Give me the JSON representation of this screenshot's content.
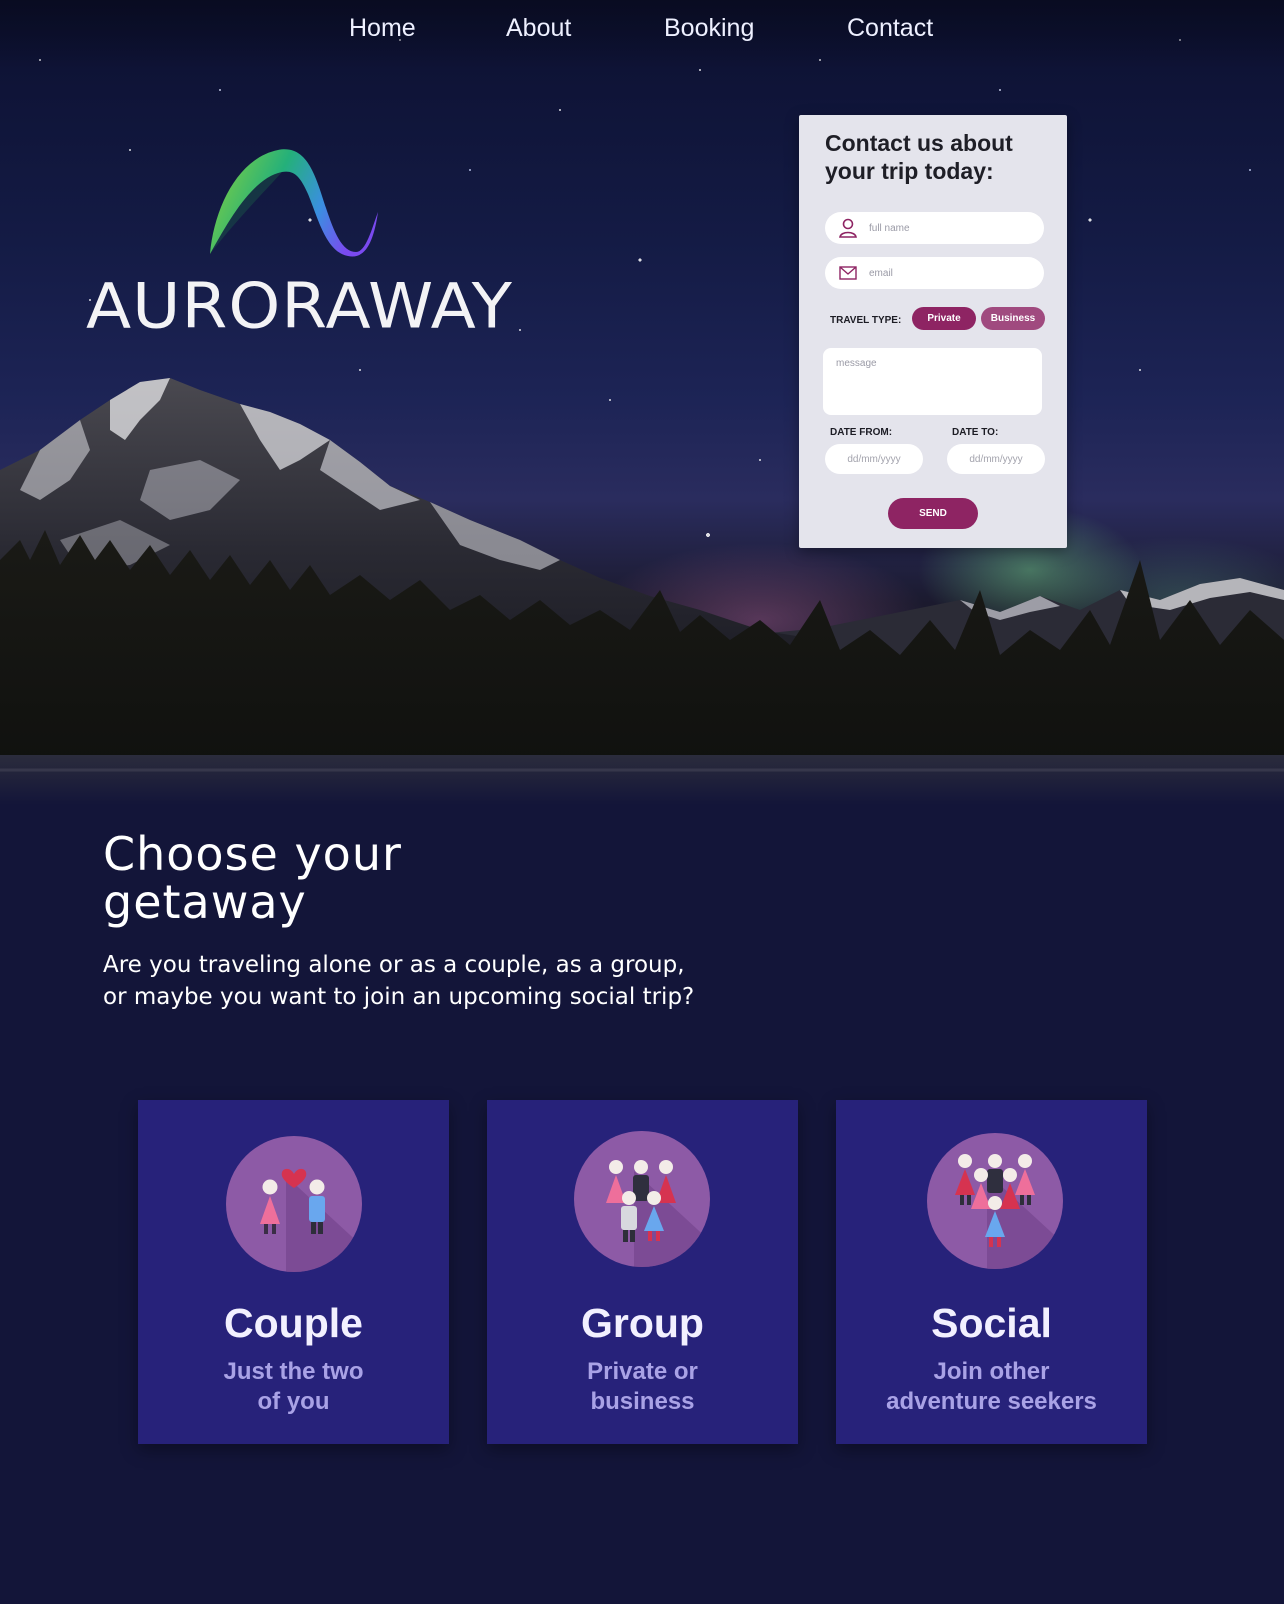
{
  "nav": {
    "items": [
      {
        "label": "Home"
      },
      {
        "label": "About"
      },
      {
        "label": "Booking"
      },
      {
        "label": "Contact"
      }
    ]
  },
  "brand": {
    "name": "AURORAWAY",
    "logo_icon": "aurora-wave-logo-icon"
  },
  "contact_form": {
    "title": "Contact us about your trip today:",
    "full_name_placeholder": "full name",
    "email_placeholder": "email",
    "travel_type_label": "TRAVEL TYPE:",
    "travel_type_options": [
      "Private",
      "Business"
    ],
    "travel_type_selected": "Private",
    "message_placeholder": "message",
    "date_from_label": "DATE FROM:",
    "date_to_label": "DATE TO:",
    "date_from_placeholder": "dd/mm/yyyy",
    "date_to_placeholder": "dd/mm/yyyy",
    "send_label": "SEND",
    "icons": [
      "user-icon",
      "mail-icon"
    ]
  },
  "getaway": {
    "title_lines": [
      "Choose your",
      "getaway"
    ],
    "subtitle_lines": [
      "Are you traveling alone or as a couple, as a group,",
      "or maybe you want to join an upcoming social trip?"
    ]
  },
  "cards": [
    {
      "title": "Couple",
      "sub_lines": [
        "Just the two",
        "of you"
      ],
      "icon": "couple-icon"
    },
    {
      "title": "Group",
      "sub_lines": [
        "Private or",
        "business"
      ],
      "icon": "group-icon"
    },
    {
      "title": "Social",
      "sub_lines": [
        "Join other",
        "adventure seekers"
      ],
      "icon": "social-group-icon"
    }
  ],
  "colors": {
    "page_background": "#131539",
    "card_background": "#27227a",
    "card_subtitle": "#a9a2e6",
    "accent": "#8e2463",
    "accent_secondary": "#a04a7f",
    "form_background": "#e4e4ec",
    "icon_circle": "#8d5aa6"
  }
}
